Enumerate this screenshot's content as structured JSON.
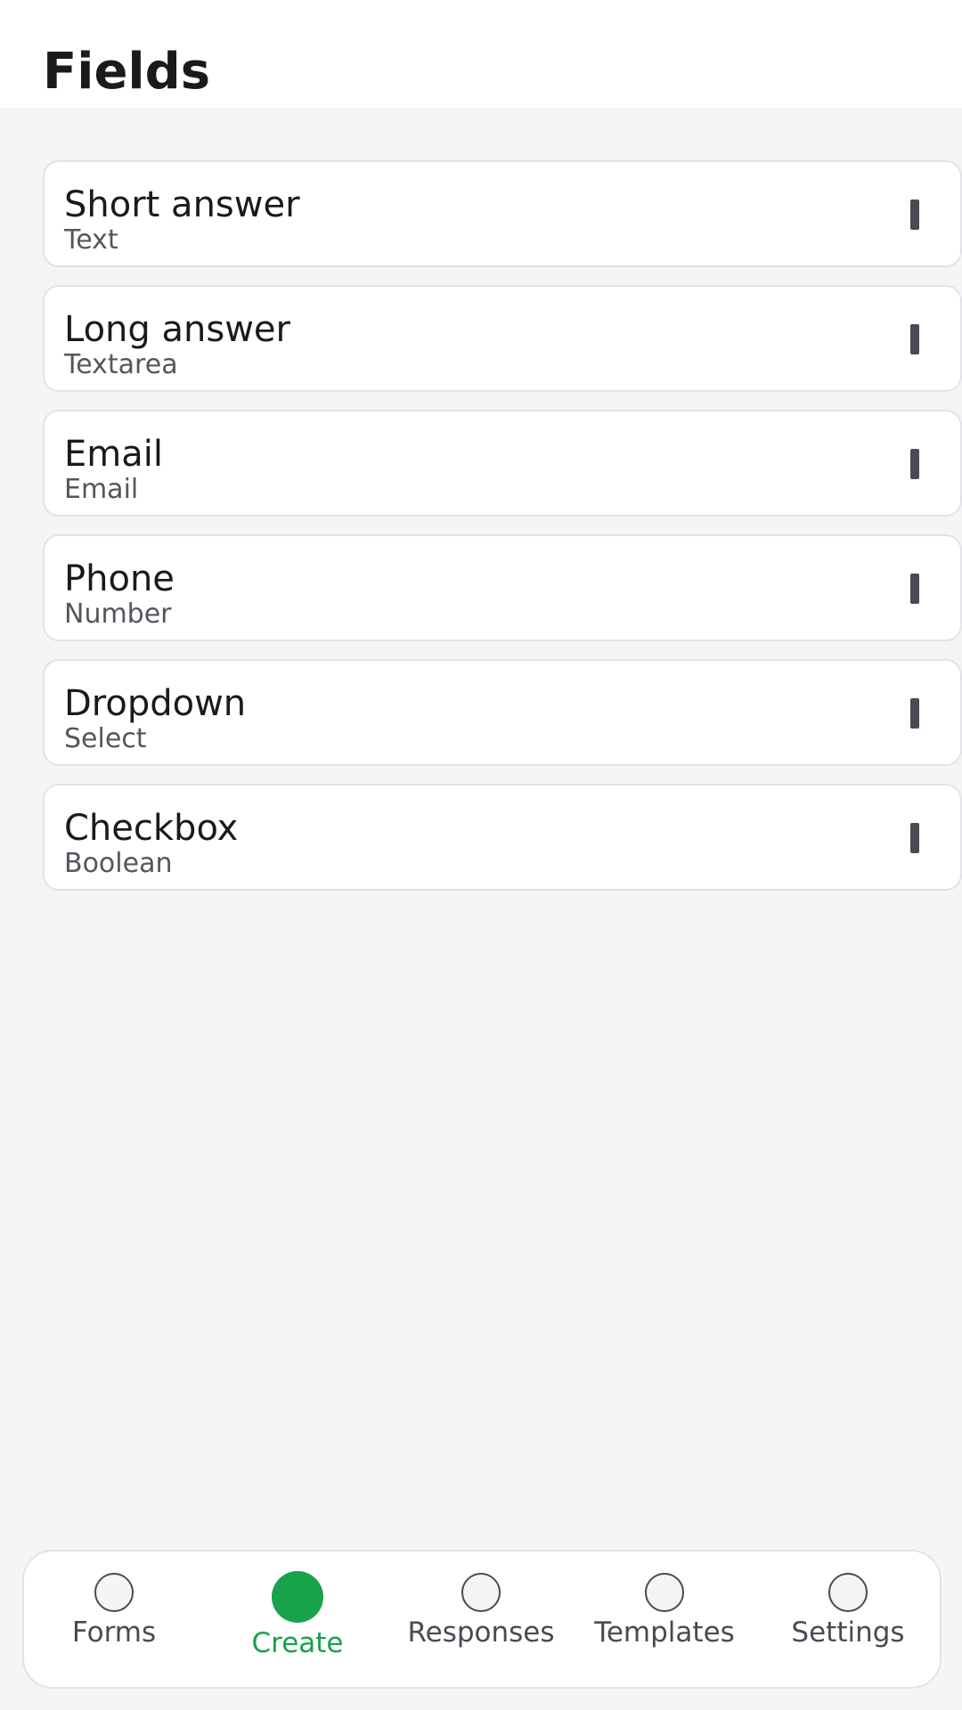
{
  "header": {
    "title": "Fields"
  },
  "fields": [
    {
      "name": "Short answer",
      "type": "Text"
    },
    {
      "name": "Long answer",
      "type": "Textarea"
    },
    {
      "name": "Email",
      "type": "Email"
    },
    {
      "name": "Phone",
      "type": "Number"
    },
    {
      "name": "Dropdown",
      "type": "Select"
    },
    {
      "name": "Checkbox",
      "type": "Boolean"
    }
  ],
  "tabs": [
    {
      "label": "Forms",
      "icon": "circle-icon",
      "active": false
    },
    {
      "label": "Create",
      "icon": "circle-icon",
      "active": true
    },
    {
      "label": "Responses",
      "icon": "circle-icon",
      "active": false
    },
    {
      "label": "Templates",
      "icon": "circle-icon",
      "active": false
    },
    {
      "label": "Settings",
      "icon": "circle-icon",
      "active": false
    }
  ],
  "colors": {
    "accent": "#16a34a",
    "background": "#f4f5f7",
    "card": "#ffffff"
  }
}
